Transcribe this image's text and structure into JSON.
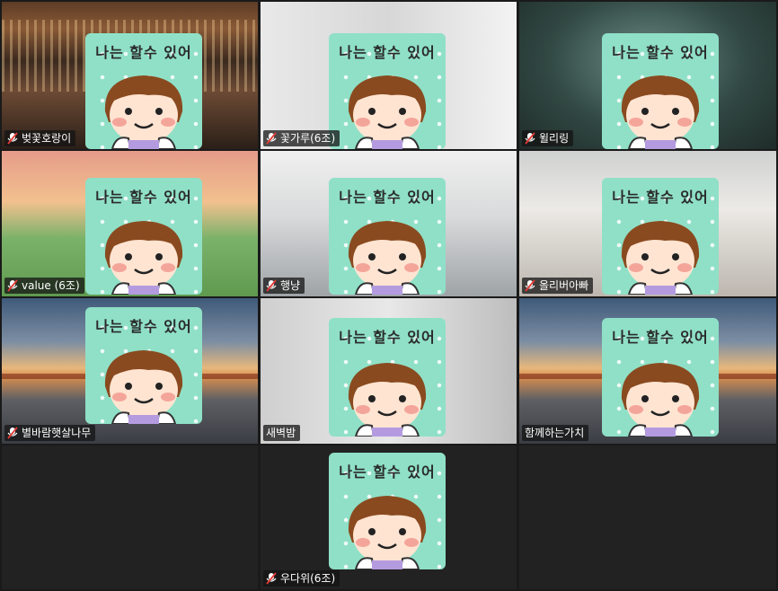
{
  "sticker_text": "나는 할수 있어",
  "participants": [
    {
      "name": "벚꽃호랑이",
      "muted": true
    },
    {
      "name": "꽃가루(6조)",
      "muted": true
    },
    {
      "name": "윌리링",
      "muted": true
    },
    {
      "name": "value (6조)",
      "muted": true
    },
    {
      "name": "행냥",
      "muted": true
    },
    {
      "name": "올리버아빠",
      "muted": true
    },
    {
      "name": "별바람햇살나무",
      "muted": true
    },
    {
      "name": "새벽밤",
      "muted": false
    },
    {
      "name": "함께하는가치",
      "muted": false
    },
    {
      "name": "우다위(6조)",
      "muted": true
    }
  ],
  "colors": {
    "active_speaker": "#3fd16b",
    "sticker_bg": "#8fe0c6"
  }
}
